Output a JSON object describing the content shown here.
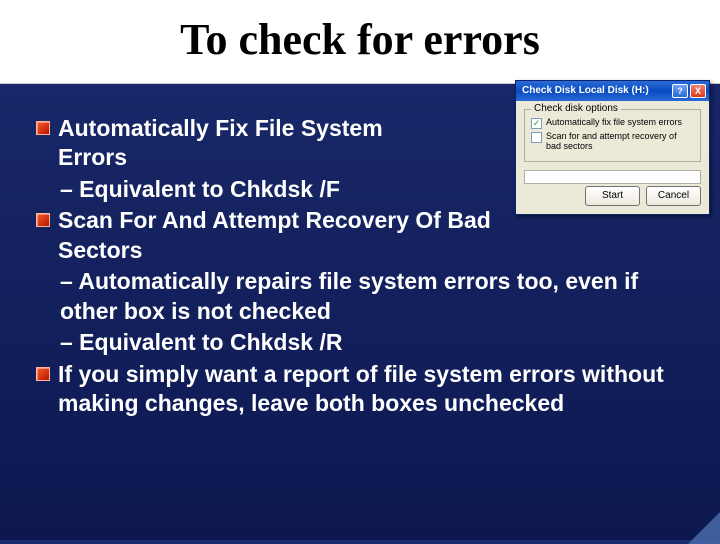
{
  "title": "To check for errors",
  "bullets": {
    "b1": "Automatically Fix File System Errors",
    "b1_sub1": "–  Equivalent to Chkdsk /F",
    "b2": "Scan For And Attempt Recovery Of Bad Sectors",
    "b2_sub1": "– Automatically repairs file system errors too, even if other box is not checked",
    "b2_sub2": "– Equivalent to Chkdsk /R",
    "b3": "If you simply want a report of file system errors without making changes, leave both boxes unchecked"
  },
  "dialog": {
    "title": "Check Disk Local Disk (H:)",
    "help_glyph": "?",
    "close_glyph": "X",
    "group_label": "Check disk options",
    "opt1": "Automatically fix file system errors",
    "opt1_checked": "✓",
    "opt2": "Scan for and attempt recovery of bad sectors",
    "start": "Start",
    "cancel": "Cancel"
  }
}
